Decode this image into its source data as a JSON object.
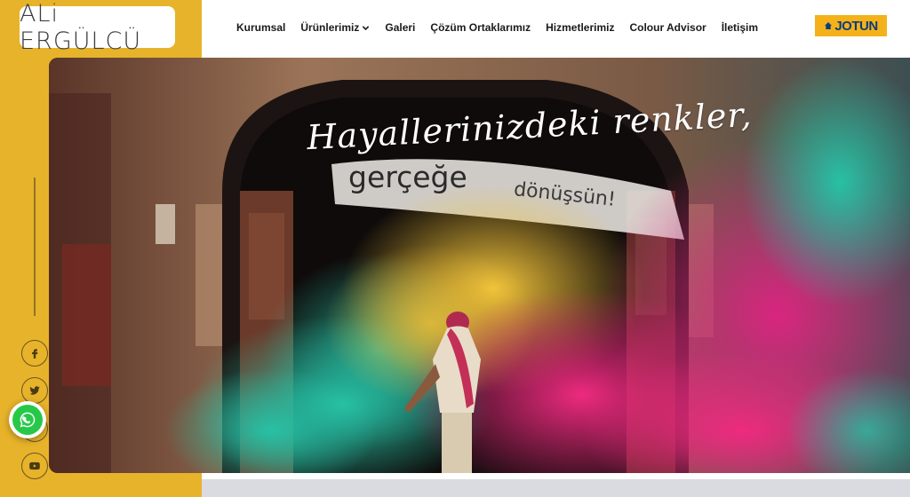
{
  "brand": {
    "logo_text": "ALi ERGÜLCÜ"
  },
  "nav": {
    "items": [
      {
        "label": "Kurumsal"
      },
      {
        "label": "Ürünlerimiz",
        "has_dropdown": true
      },
      {
        "label": "Galeri"
      },
      {
        "label": "Çözüm Ortaklarımız"
      },
      {
        "label": "Hizmetlerimiz"
      },
      {
        "label": "Colour Advisor"
      },
      {
        "label": "İletişim"
      }
    ]
  },
  "partner": {
    "logo_text": "JOTUN",
    "bg_color": "#f4b21a",
    "text_color": "#0c3b7e"
  },
  "hero": {
    "line1": "Hayallerinizdeki renkler,",
    "line2": "gerçeğe",
    "line3": "dönüşsün!"
  },
  "social": {
    "icons": [
      "facebook-icon",
      "twitter-icon",
      "instagram-icon",
      "youtube-icon"
    ]
  },
  "whatsapp": {
    "icon": "whatsapp-icon",
    "color": "#26c947"
  },
  "colors": {
    "rail": "#e7b32a",
    "accent_pink": "#e8237a",
    "accent_teal": "#1fb59b",
    "accent_yellow": "#e8b830"
  }
}
